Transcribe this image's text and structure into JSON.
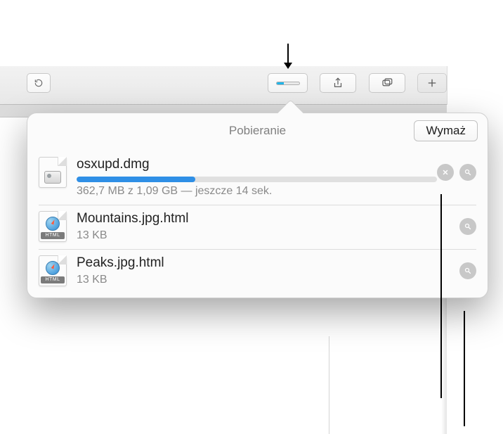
{
  "toolbar": {
    "downloads_btn_progress_pct": 33
  },
  "popover": {
    "title": "Pobieranie",
    "clear_label": "Wymaż"
  },
  "downloads": [
    {
      "name": "osxupd.dmg",
      "status_line": "362,7 MB z 1,09 GB — jeszcze 14 sek.",
      "progress_pct": 33,
      "kind": "dmg",
      "in_progress": true
    },
    {
      "name": "Mountains.jpg.html",
      "status_line": "13 KB",
      "kind": "html",
      "in_progress": false
    },
    {
      "name": "Peaks.jpg.html",
      "status_line": "13 KB",
      "kind": "html",
      "in_progress": false
    }
  ],
  "icon_labels": {
    "html_badge": "HTML"
  }
}
